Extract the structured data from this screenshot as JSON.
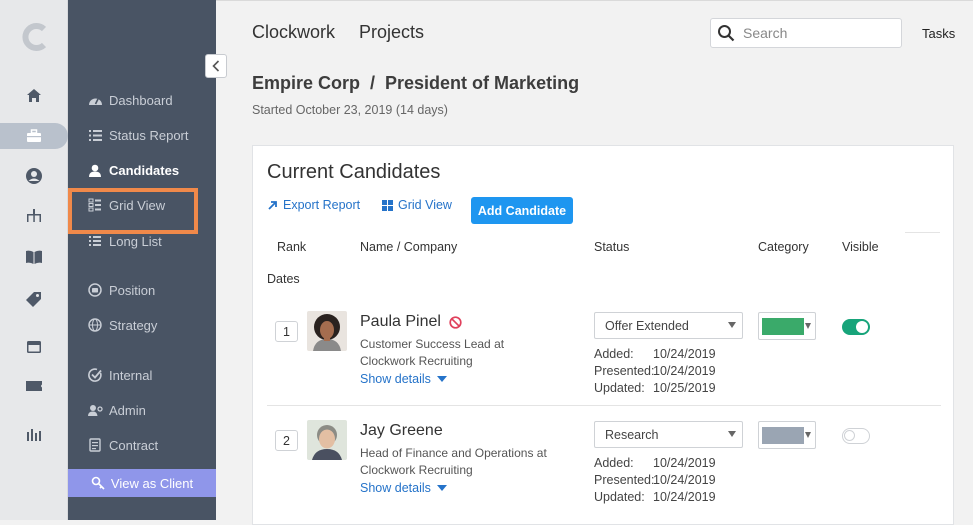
{
  "app": {
    "brand": "Clockwork",
    "section": "Projects"
  },
  "search": {
    "placeholder": "Search"
  },
  "tasks_label": "Tasks",
  "project": {
    "title": "Empire Corp  /  President of Marketing",
    "started": "Started October 23, 2019 (14 days)"
  },
  "sidebar": {
    "items": [
      {
        "label": "Dashboard",
        "icon": "dashboard-icon"
      },
      {
        "label": "Status Report",
        "icon": "status-report-icon"
      },
      {
        "label": "Candidates",
        "icon": "user-icon"
      },
      {
        "label": "Grid View",
        "icon": "grid-list-icon"
      },
      {
        "label": "Long List",
        "icon": "list-icon"
      },
      {
        "label": "Position",
        "icon": "position-icon"
      },
      {
        "label": "Strategy",
        "icon": "globe-icon"
      },
      {
        "label": "Internal",
        "icon": "check-circle-icon"
      },
      {
        "label": "Admin",
        "icon": "admin-icon"
      },
      {
        "label": "Contract",
        "icon": "contract-icon"
      }
    ],
    "view_as_client": "View as Client"
  },
  "rail": {
    "icons": [
      "home-icon",
      "briefcase-icon",
      "person-circle-icon",
      "org-chart-icon",
      "book-icon",
      "tag-icon",
      "calendar-icon",
      "ticket-icon",
      "bar-chart-icon"
    ]
  },
  "card": {
    "title": "Current Candidates",
    "export_label": "Export Report",
    "grid_label": "Grid View",
    "add_label": "Add Candidate",
    "columns": {
      "rank": "Rank",
      "name": "Name / Company",
      "status": "Status",
      "category": "Category",
      "visible": "Visible",
      "dates": "Dates"
    },
    "candidates": [
      {
        "rank": "1",
        "name": "Paula Pinel",
        "description": "Customer Success Lead at Clockwork Recruiting",
        "show_details": "Show details",
        "status": "Offer Extended",
        "added_label": "Added:",
        "added": "10/24/2019",
        "presented_label": "Presented:",
        "presented": "10/24/2019",
        "updated_label": "Updated:",
        "updated": "10/25/2019",
        "category_color": "#3aaa6a",
        "visible": true
      },
      {
        "rank": "2",
        "name": "Jay Greene",
        "description": "Head of Finance and Operations at Clockwork Recruiting",
        "show_details": "Show details",
        "status": "Research",
        "added_label": "Added:",
        "added": "10/24/2019",
        "presented_label": "Presented:",
        "presented": "10/24/2019",
        "updated_label": "Updated:",
        "updated": "10/24/2019",
        "category_color": "#9aa5b3",
        "visible": false
      }
    ]
  }
}
